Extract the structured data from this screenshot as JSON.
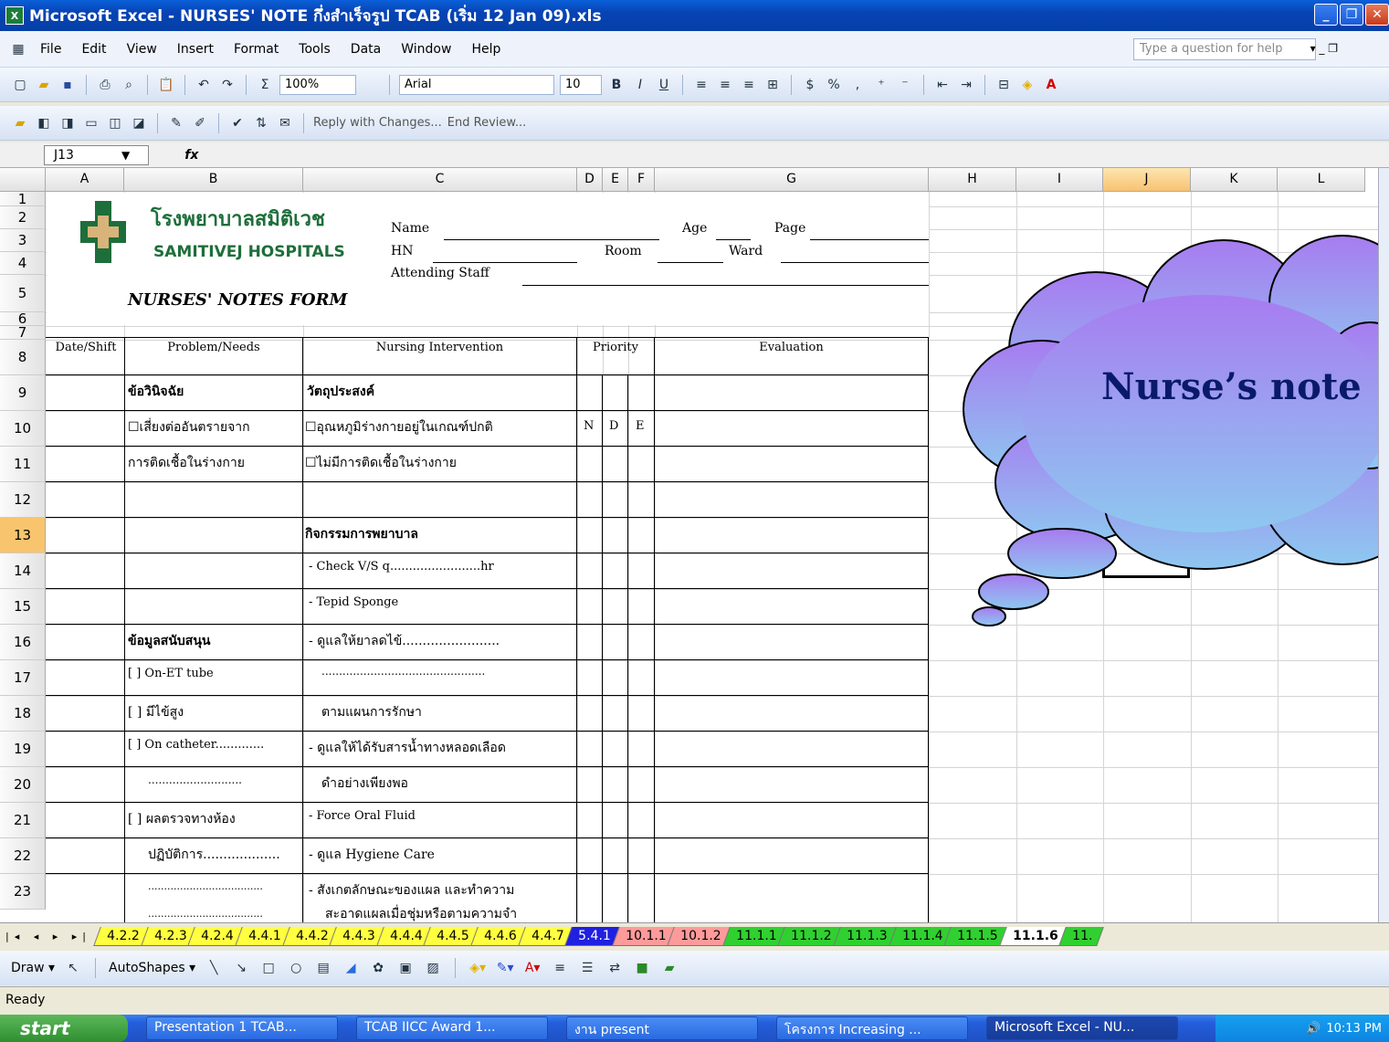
{
  "window": {
    "title": "Microsoft Excel - NURSES' NOTE กึ่งสำเร็จรูป TCAB (เริ่ม 12 Jan 09).xls",
    "icon": "excel-icon",
    "controls": [
      "minimize",
      "restore",
      "close"
    ]
  },
  "menubar": {
    "items": [
      "File",
      "Edit",
      "View",
      "Insert",
      "Format",
      "Tools",
      "Data",
      "Window",
      "Help"
    ],
    "help_placeholder": "Type a question for help"
  },
  "toolbar": {
    "zoom": "100%",
    "font": "Arial",
    "font_size": "10",
    "review_reply": "Reply with Changes...",
    "review_end": "End Review..."
  },
  "formula_bar": {
    "name_box": "J13",
    "fx": "fx",
    "value": ""
  },
  "columns": [
    "A",
    "B",
    "C",
    "D",
    "E",
    "F",
    "G",
    "H",
    "I",
    "J",
    "K",
    "L"
  ],
  "rows": [
    "1",
    "2",
    "3",
    "4",
    "5",
    "6",
    "7",
    "8",
    "9",
    "10",
    "11",
    "12",
    "13",
    "14",
    "15",
    "16",
    "17",
    "18",
    "19",
    "20",
    "21",
    "22",
    "23"
  ],
  "selected_cell": "J13",
  "header": {
    "hospital_th": "โรงพยาบาลสมิติเวช",
    "hospital_en": "SAMITIVEJ HOSPITALS",
    "name_label": "Name",
    "age_label": "Age",
    "page_label": "Page",
    "hn_label": "HN",
    "room_label": "Room",
    "ward_label": "Ward",
    "attending_label": "Attending Staff",
    "form_title": "NURSES' NOTES FORM"
  },
  "table_headers": {
    "date_shift": "Date/Shift",
    "problem": "Problem/Needs",
    "intervention": "Nursing Intervention",
    "priority": "Priority",
    "evaluation": "Evaluation"
  },
  "cells": {
    "r8b": "ข้อวินิจฉัย",
    "r8c": "วัตถุประสงค์",
    "r9b": "☐เสี่ยงต่ออันตรายจาก",
    "r9c": "☐อุณหภูมิร่างกายอยู่ในเกณฑ์ปกติ",
    "r9d": "N",
    "r9e": "D",
    "r9f": "E",
    "r10b": "การติดเชื้อในร่างกาย",
    "r10c": "☐ไม่มีการติดเชื้อในร่างกาย",
    "r12c": "กิจกรรมการพยาบาล",
    "r13c": "- Check V/S  q........................hr",
    "r14c": "- Tepid Sponge",
    "r15b": "ข้อมูลสนับสนุน",
    "r15c": "- ดูแลให้ยาลดไข้........................",
    "r16b": "[ ] On-ET tube",
    "r16c": "...............................................",
    "r17b": "[ ] มีไข้สูง",
    "r17c": "ตามแผนการรักษา",
    "r18b": "[ ] On catheter.............",
    "r18c": "- ดูแลให้ได้รับสารน้ำทางหลอดเลือด",
    "r19b": "...........................",
    "r19c": "ดำอย่างเพียงพอ",
    "r20b": "[ ] ผลตรวจทางห้อง",
    "r20c": "- Force Oral Fluid",
    "r21b": "ปฏิบัติการ...................",
    "r21c": "- ดูแล  Hygiene Care",
    "r22b": "....................................",
    "r22c": "- สังเกตลักษณะของแผล และทำความ",
    "r23b": "....................................",
    "r23c": "สะอาดแผลเมื่อชุ่มหรือตามความจำ"
  },
  "callout": {
    "text": "Nurse’s note"
  },
  "sheet_tabs": [
    {
      "label": "4.2.2",
      "color": "#ffff40"
    },
    {
      "label": "4.2.3",
      "color": "#ffff40"
    },
    {
      "label": "4.2.4",
      "color": "#ffff40"
    },
    {
      "label": "4.4.1",
      "color": "#ffff40"
    },
    {
      "label": "4.4.2",
      "color": "#ffff40"
    },
    {
      "label": "4.4.3",
      "color": "#ffff40"
    },
    {
      "label": "4.4.4",
      "color": "#ffff40"
    },
    {
      "label": "4.4.5",
      "color": "#ffff40"
    },
    {
      "label": "4.4.6",
      "color": "#ffff40"
    },
    {
      "label": "4.4.7",
      "color": "#ffff40"
    },
    {
      "label": "5.4.1",
      "color": "#2020e0"
    },
    {
      "label": "10.1.1",
      "color": "#ff9a9a"
    },
    {
      "label": "10.1.2",
      "color": "#ff9a9a"
    },
    {
      "label": "11.1.1",
      "color": "#30d030"
    },
    {
      "label": "11.1.2",
      "color": "#30d030"
    },
    {
      "label": "11.1.3",
      "color": "#30d030"
    },
    {
      "label": "11.1.4",
      "color": "#30d030"
    },
    {
      "label": "11.1.5",
      "color": "#30d030"
    },
    {
      "label": "11.1.6",
      "color": "#ffffff"
    },
    {
      "label": "11.",
      "color": "#30d030"
    }
  ],
  "drawbar": {
    "draw": "Draw ▾",
    "autoshapes": "AutoShapes ▾"
  },
  "status": "Ready",
  "taskbar": {
    "start": "start",
    "buttons": [
      "Presentation 1 TCAB...",
      "TCAB IICC Award 1...",
      "งาน present",
      "โครงการ Increasing ...",
      "Microsoft Excel - NU..."
    ],
    "clock": "10:13 PM"
  },
  "colors": {
    "title_blue": "#0743b4",
    "cloud_top": "#a77cf0",
    "cloud_bottom": "#8ec8f0",
    "hospital_green": "#1d6e3a"
  }
}
